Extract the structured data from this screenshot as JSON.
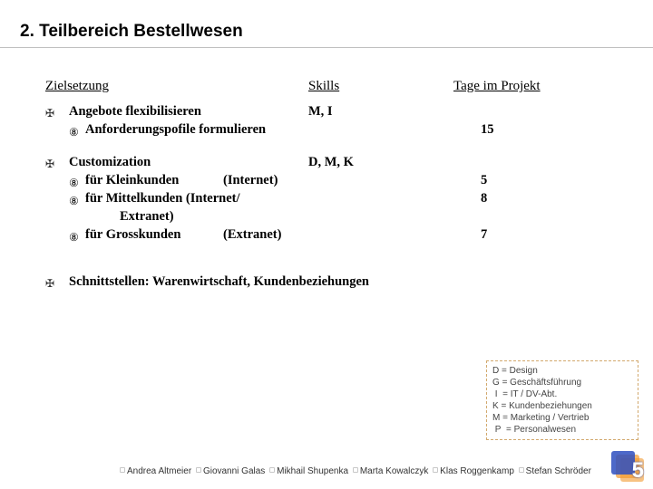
{
  "title": "2. Teilbereich Bestellwesen",
  "headers": {
    "ziel": "Zielsetzung",
    "skills": "Skills",
    "tage": "Tage im Projekt"
  },
  "items": [
    {
      "label": "Angebote flexibilisieren",
      "skills": "M, I",
      "subs": [
        {
          "label": "Anforderungspofile formulieren",
          "days": "15"
        }
      ]
    },
    {
      "label": "Customization",
      "skills": "D, M, K",
      "subs": [
        {
          "label": "für Kleinkunden",
          "paren": "(Internet)",
          "days": "5"
        },
        {
          "label": "für Mittelkunden",
          "paren_join": "(Internet/",
          "days": "8"
        },
        {
          "label2": "Extranet)"
        },
        {
          "label": "für Grosskunden",
          "paren": "(Extranet)",
          "days": "7"
        }
      ]
    },
    {
      "label": "Schnittstellen: Warenwirtschaft, Kundenbeziehungen"
    }
  ],
  "legend": [
    {
      "k": "D",
      "v": "= Design"
    },
    {
      "k": "G",
      "v": "= Geschäftsführung"
    },
    {
      "k": "I",
      "v": "= IT / DV-Abt."
    },
    {
      "k": "K",
      "v": "= Kundenbeziehungen"
    },
    {
      "k": "M",
      "v": "= Marketing / Vertrieb"
    },
    {
      "k": "P",
      "v": "= Personalwesen"
    }
  ],
  "footer": [
    "Andrea Altmeier",
    "Giovanni Galas",
    "Mikhail Shupenka",
    "Marta Kowalczyk",
    "Klas Roggenkamp",
    "Stefan Schröder"
  ],
  "logo_num": "5"
}
